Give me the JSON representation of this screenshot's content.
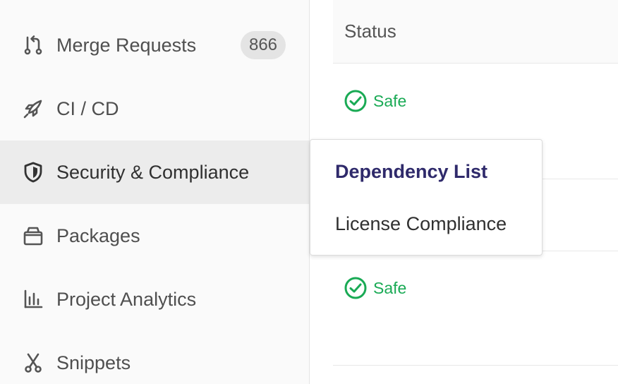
{
  "sidebar": {
    "items": [
      {
        "label": "Merge Requests",
        "icon": "merge-request-icon",
        "badge": "866"
      },
      {
        "label": "CI / CD",
        "icon": "rocket-icon"
      },
      {
        "label": "Security & Compliance",
        "icon": "shield-icon",
        "active": true
      },
      {
        "label": "Packages",
        "icon": "package-icon"
      },
      {
        "label": "Project Analytics",
        "icon": "chart-icon"
      },
      {
        "label": "Snippets",
        "icon": "scissors-icon"
      }
    ]
  },
  "table": {
    "header": "Status",
    "rows": [
      {
        "status": "Safe"
      },
      {
        "status": "Safe"
      }
    ]
  },
  "flyout": {
    "items": [
      {
        "label": "Dependency List"
      },
      {
        "label": "License Compliance"
      }
    ]
  },
  "colors": {
    "safe": "#1aaa55",
    "flyout_primary": "#2f2a6b",
    "active_bg": "#ececec"
  }
}
